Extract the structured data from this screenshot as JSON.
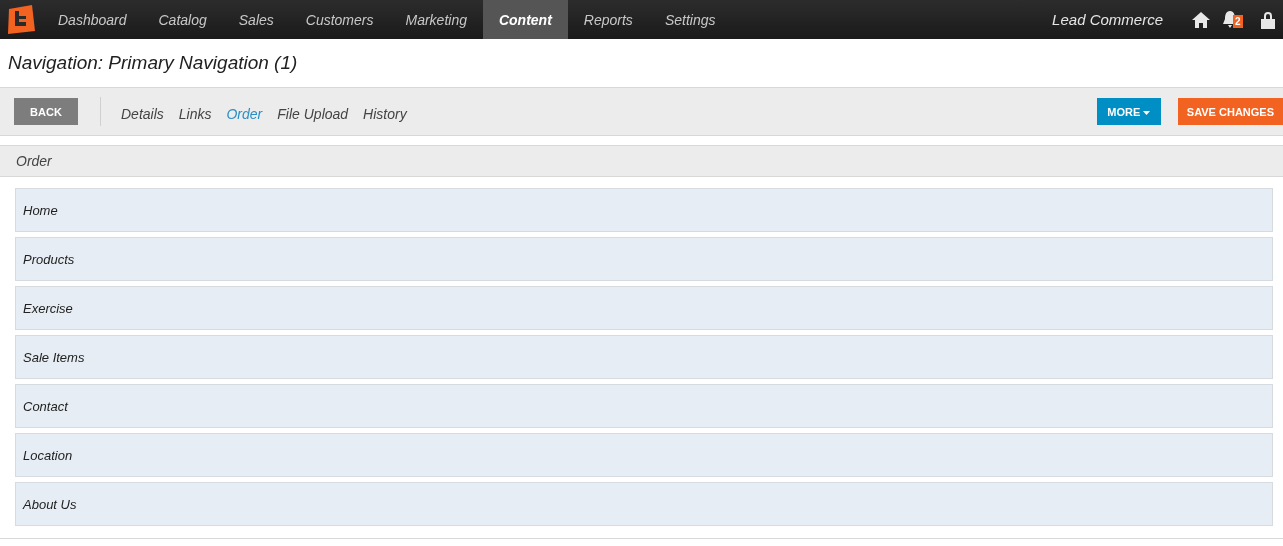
{
  "topnav": {
    "items": [
      {
        "label": "Dashboard",
        "selected": false
      },
      {
        "label": "Catalog",
        "selected": false
      },
      {
        "label": "Sales",
        "selected": false
      },
      {
        "label": "Customers",
        "selected": false
      },
      {
        "label": "Marketing",
        "selected": false
      },
      {
        "label": "Content",
        "selected": true
      },
      {
        "label": "Reports",
        "selected": false
      },
      {
        "label": "Settings",
        "selected": false
      }
    ],
    "store_name": "Lead Commerce",
    "notification_count": "2"
  },
  "page_title": "Navigation: Primary Navigation (1)",
  "toolbar": {
    "back_button": "BACK",
    "tabs": [
      {
        "label": "Details",
        "selected": false
      },
      {
        "label": "Links",
        "selected": false
      },
      {
        "label": "Order",
        "selected": true
      },
      {
        "label": "File Upload",
        "selected": false
      },
      {
        "label": "History",
        "selected": false
      }
    ],
    "more_button": "MORE",
    "save_button": "SAVE CHANGES"
  },
  "section": {
    "title": "Order",
    "items": [
      "Home",
      "Products",
      "Exercise",
      "Sale Items",
      "Contact",
      "Location",
      "About Us"
    ]
  }
}
